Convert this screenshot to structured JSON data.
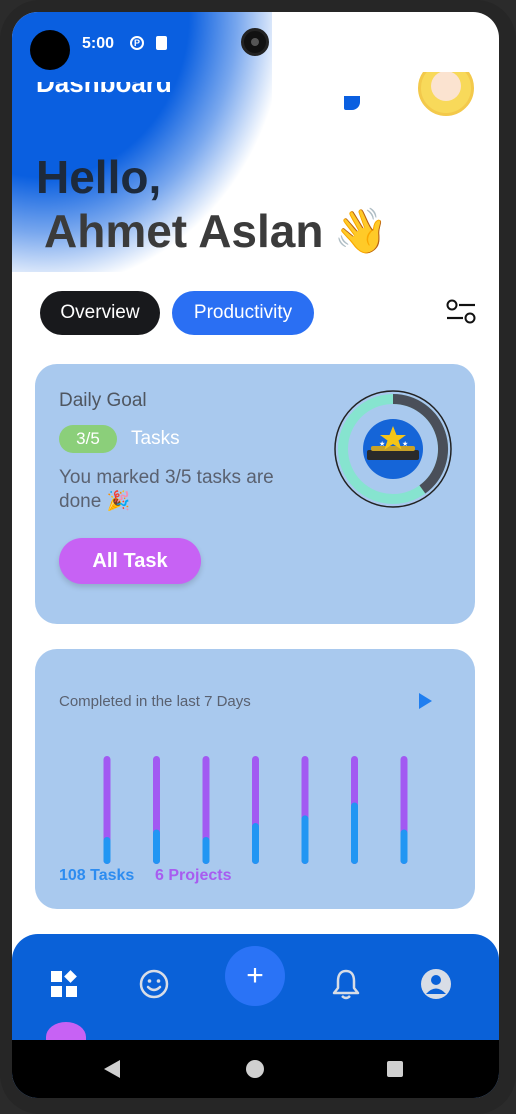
{
  "status_bar": {
    "time": "5:00",
    "icon_1": "signal-app-icon",
    "icon_2": "sd-card-icon"
  },
  "header": {
    "title": "Dashboard"
  },
  "greeting": {
    "hello": "Hello,",
    "name": "Ahmet Aslan",
    "emoji": "👋"
  },
  "tabs": [
    {
      "label": "Overview",
      "active": false
    },
    {
      "label": "Productivity",
      "active": true
    }
  ],
  "daily_goal": {
    "title": "Daily Goal",
    "count": "3/5",
    "count_label": "Tasks",
    "message": "You marked 3/5 tasks are done 🎉",
    "button": "All Task",
    "progress": 0.6
  },
  "chart_card": {
    "title": "Completed in the last 7 Days",
    "tasks_label": "108 Tasks",
    "projects_label": "6 Projects"
  },
  "chart_data": {
    "type": "bar",
    "series": [
      {
        "values": [
          0.25,
          0.32,
          0.25,
          0.38,
          0.45,
          0.57,
          0.32
        ]
      },
      {
        "values": [
          1,
          1,
          1,
          1,
          1,
          1,
          1
        ]
      }
    ],
    "colors": {
      "tasks": "#2196f3",
      "projects": "#a259f2"
    }
  },
  "colors": {
    "accent": "#0a61d8",
    "pill_green": "#8bcf7a",
    "button_purple": "#c762f4",
    "card": "#a9c9ee"
  },
  "bottom_nav": [
    "dashboard-icon",
    "smiley-icon",
    "plus-icon",
    "bell-icon",
    "profile-icon"
  ]
}
